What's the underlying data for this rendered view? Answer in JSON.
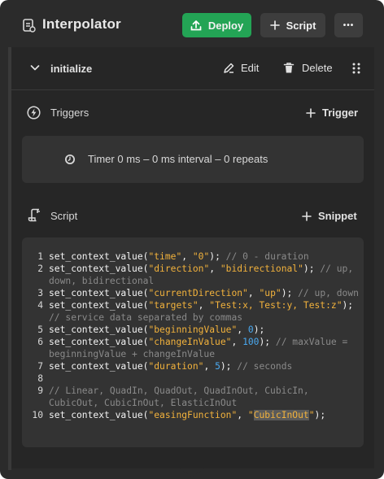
{
  "header": {
    "title": "Interpolator",
    "deploy_label": "Deploy",
    "script_label": "Script",
    "more_label": "•••"
  },
  "initialize": {
    "label": "initialize",
    "edit_label": "Edit",
    "delete_label": "Delete"
  },
  "triggers": {
    "title": "Triggers",
    "add_label": "Trigger",
    "items": [
      {
        "text": "Timer 0 ms – 0 ms interval – 0 repeats"
      }
    ]
  },
  "script": {
    "title": "Script",
    "add_label": "Snippet",
    "lines": [
      {
        "num": "1",
        "segs": [
          {
            "t": "set_context_value(",
            "c": "fn"
          },
          {
            "t": "\"time\"",
            "c": "str"
          },
          {
            "t": ", ",
            "c": "fn"
          },
          {
            "t": "\"0\"",
            "c": "str"
          },
          {
            "t": "); ",
            "c": "fn"
          },
          {
            "t": "// 0 - duration",
            "c": "cmt"
          }
        ]
      },
      {
        "num": "2",
        "segs": [
          {
            "t": "set_context_value(",
            "c": "fn"
          },
          {
            "t": "\"direction\"",
            "c": "str"
          },
          {
            "t": ", ",
            "c": "fn"
          },
          {
            "t": "\"bidirectional\"",
            "c": "str"
          },
          {
            "t": "); ",
            "c": "fn"
          },
          {
            "t": "// up, down, bidirectional",
            "c": "cmt"
          }
        ]
      },
      {
        "num": "3",
        "segs": [
          {
            "t": "set_context_value(",
            "c": "fn"
          },
          {
            "t": "\"currentDirection\"",
            "c": "str"
          },
          {
            "t": ", ",
            "c": "fn"
          },
          {
            "t": "\"up\"",
            "c": "str"
          },
          {
            "t": "); ",
            "c": "fn"
          },
          {
            "t": "// up, down",
            "c": "cmt"
          }
        ]
      },
      {
        "num": "4",
        "segs": [
          {
            "t": "set_context_value(",
            "c": "fn"
          },
          {
            "t": "\"targets\"",
            "c": "str"
          },
          {
            "t": ", ",
            "c": "fn"
          },
          {
            "t": "\"Test:x, Test:y, Test:z\"",
            "c": "str"
          },
          {
            "t": "); ",
            "c": "fn"
          },
          {
            "t": "// service data separated by commas",
            "c": "cmt"
          }
        ]
      },
      {
        "num": "5",
        "segs": [
          {
            "t": "set_context_value(",
            "c": "fn"
          },
          {
            "t": "\"beginningValue\"",
            "c": "str"
          },
          {
            "t": ", ",
            "c": "fn"
          },
          {
            "t": "0",
            "c": "numv"
          },
          {
            "t": ");",
            "c": "fn"
          }
        ]
      },
      {
        "num": "6",
        "segs": [
          {
            "t": "set_context_value(",
            "c": "fn"
          },
          {
            "t": "\"changeInValue\"",
            "c": "str"
          },
          {
            "t": ", ",
            "c": "fn"
          },
          {
            "t": "100",
            "c": "numv"
          },
          {
            "t": "); ",
            "c": "fn"
          },
          {
            "t": "// maxValue = beginningValue + changeInValue",
            "c": "cmt"
          }
        ]
      },
      {
        "num": "7",
        "segs": [
          {
            "t": "set_context_value(",
            "c": "fn"
          },
          {
            "t": "\"duration\"",
            "c": "str"
          },
          {
            "t": ", ",
            "c": "fn"
          },
          {
            "t": "5",
            "c": "numv"
          },
          {
            "t": "); ",
            "c": "fn"
          },
          {
            "t": "// seconds",
            "c": "cmt"
          }
        ]
      },
      {
        "num": "8",
        "segs": [
          {
            "t": " ",
            "c": "fn"
          }
        ]
      },
      {
        "num": "9",
        "segs": [
          {
            "t": "// Linear, QuadIn, QuadOut, QuadInOut, CubicIn, CubicOut, CubicInOut, ElasticInOut",
            "c": "cmt"
          }
        ]
      },
      {
        "num": "10",
        "segs": [
          {
            "t": "set_context_value(",
            "c": "fn"
          },
          {
            "t": "\"easingFunction\"",
            "c": "str"
          },
          {
            "t": ", ",
            "c": "fn"
          },
          {
            "t": "\"",
            "c": "str"
          },
          {
            "t": "CubicInOut",
            "c": "str hl"
          },
          {
            "t": "\"",
            "c": "str"
          },
          {
            "t": ");",
            "c": "fn"
          }
        ]
      }
    ]
  },
  "colors": {
    "accent_green": "#23a455",
    "string": "#f2b23c",
    "number": "#4aa9f0",
    "comment": "#8a8a8a"
  }
}
